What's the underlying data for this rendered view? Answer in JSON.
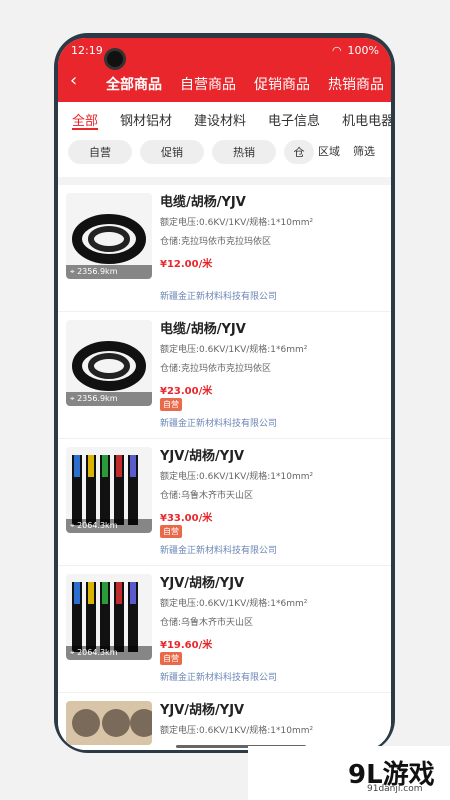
{
  "status": {
    "time": "12:19",
    "battery": "100%"
  },
  "header": {
    "tabs": [
      "全部商品",
      "自营商品",
      "促销商品",
      "热销商品"
    ],
    "active_tab": 0,
    "back_icon": "back-arrow-icon"
  },
  "categories": [
    "全部",
    "钢材铝材",
    "建设材料",
    "电子信息",
    "机电电器"
  ],
  "filters": {
    "pills": [
      "自营",
      "促销",
      "热销",
      "仓"
    ],
    "right_labels": [
      "区域",
      "筛选"
    ]
  },
  "products": [
    {
      "title": "电缆/胡杨/YJV",
      "spec": "额定电压:0.6KV/1KV/规格:1*10mm²",
      "warehouse": "仓储:克拉玛依市克拉玛依区",
      "price": "¥12.00/米",
      "badge": "",
      "company": "新疆金正新材料科技有限公司",
      "distance": "2356.9km",
      "thumb": "black-cable"
    },
    {
      "title": "电缆/胡杨/YJV",
      "spec": "额定电压:0.6KV/1KV/规格:1*6mm²",
      "warehouse": "仓储:克拉玛依市克拉玛依区",
      "price": "¥23.00/米",
      "badge": "自营",
      "company": "新疆金正新材料科技有限公司",
      "distance": "2356.9km",
      "thumb": "black-cable"
    },
    {
      "title": "YJV/胡杨/YJV",
      "spec": "额定电压:0.6KV/1KV/规格:1*10mm²",
      "warehouse": "仓储:乌鲁木齐市天山区",
      "price": "¥33.00/米",
      "badge": "自营",
      "company": "新疆金正新材料科技有限公司",
      "distance": "2064.3km",
      "thumb": "colored-wires"
    },
    {
      "title": "YJV/胡杨/YJV",
      "spec": "额定电压:0.6KV/1KV/规格:1*6mm²",
      "warehouse": "仓储:乌鲁木齐市天山区",
      "price": "¥19.60/米",
      "badge": "自营",
      "company": "新疆金正新材料科技有限公司",
      "distance": "2064.3km",
      "thumb": "colored-wires"
    },
    {
      "title": "YJV/胡杨/YJV",
      "spec": "额定电压:0.6KV/1KV/规格:1*10mm²",
      "warehouse": "",
      "price": "",
      "badge": "",
      "company": "",
      "distance": "",
      "thumb": "cable-cross"
    }
  ],
  "watermark": {
    "logo": "9L游戏",
    "url": "91danji.com"
  },
  "colors": {
    "accent": "#e8262b",
    "company": "#6a86b5",
    "badge": "#e86a4a"
  }
}
